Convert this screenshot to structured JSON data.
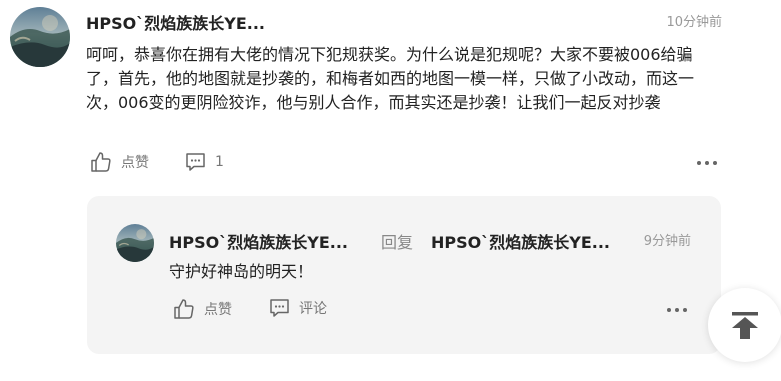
{
  "comment": {
    "username": "HPSO`烈焰族族长YE...",
    "time": "10分钟前",
    "text": "呵呵，恭喜你在拥有大佬的情况下犯规获奖。为什么说是犯规呢？大家不要被006给骗了，首先，他的地图就是抄袭的，和梅者如西的地图一模一样，只做了小改动，而这一次，006变的更阴险狡诈，他与别人合作，而其实还是抄袭！让我们一起反对抄袭",
    "like_label": "点赞",
    "reply_count": "1"
  },
  "reply": {
    "username": "HPSO`烈焰族族长YE...",
    "reply_word": "回复",
    "target_username": "HPSO`烈焰族族长YE...",
    "time": "9分钟前",
    "text": "守护好神岛的明天！",
    "like_label": "点赞",
    "comment_label": "评论"
  },
  "icons": {
    "like": "thumbs-up-icon",
    "comment": "comment-bubble-icon",
    "more": "more-dots-icon",
    "back_to_top": "back-to-top-icon"
  },
  "colors": {
    "text": "#222222",
    "muted": "#999999",
    "reply_card_bg": "#f4f4f4"
  }
}
